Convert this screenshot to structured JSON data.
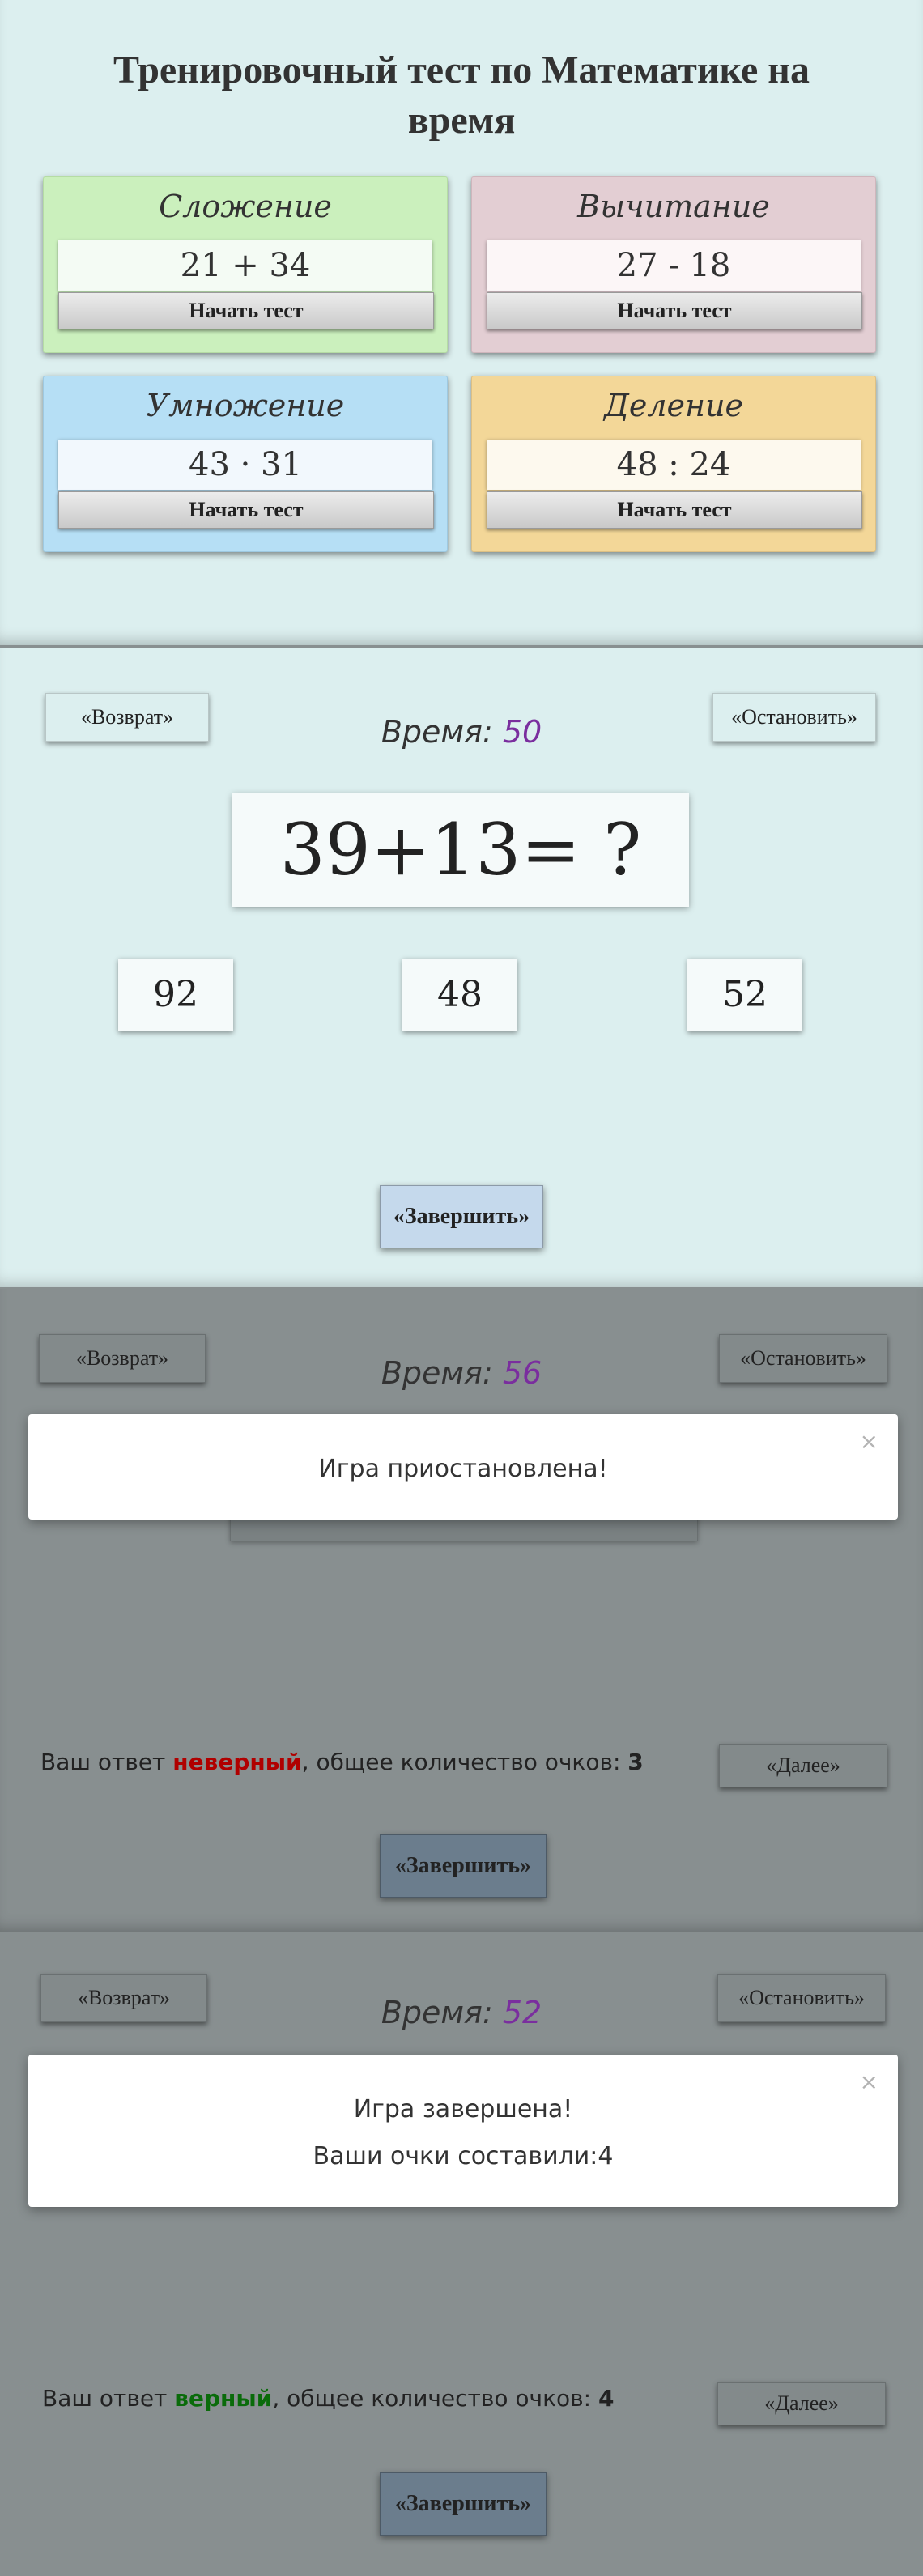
{
  "menu": {
    "title": "Тренировочный тест по Математике на время",
    "cards": [
      {
        "title": "Сложение",
        "expr": "21 + 34",
        "button": "Начать тест",
        "color": "#cbf0bd"
      },
      {
        "title": "Вычитание",
        "expr": "27 - 18",
        "button": "Начать тест",
        "color": "#e3ced3"
      },
      {
        "title": "Умножение",
        "expr": "43 · 31",
        "button": "Начать тест",
        "color": "#b6dff5"
      },
      {
        "title": "Деление",
        "expr": "48 : 24",
        "button": "Начать тест",
        "color": "#f3d798"
      }
    ]
  },
  "game": {
    "back_label": "«Возврат»",
    "pause_label": "«Остановить»",
    "timer_label": "Время:",
    "timer_value": "50",
    "question": "39+13= ?",
    "answers": [
      "92",
      "48",
      "52"
    ],
    "finish_label": "«Завершить»"
  },
  "paused": {
    "back_label": "«Возврат»",
    "pause_label": "«Остановить»",
    "timer_label": "Время:",
    "timer_value": "56",
    "modal_close": "×",
    "modal_message": "Игра приостановлена!",
    "feedback_prefix": "Ваш ответ ",
    "feedback_result": "неверный",
    "feedback_suffix": ", общее количество очков: ",
    "feedback_score": "3",
    "next_label": "«Далее»",
    "finish_label": "«Завершить»"
  },
  "finished": {
    "back_label": "«Возврат»",
    "pause_label": "«Остановить»",
    "timer_label": "Время:",
    "timer_value": "52",
    "modal_close": "×",
    "modal_title": "Игра завершена!",
    "modal_score": "Ваши очки составили:4",
    "feedback_prefix": "Ваш ответ ",
    "feedback_result": "верный",
    "feedback_suffix": ", общее количество очков: ",
    "feedback_score": "4",
    "next_label": "«Далее»",
    "finish_label": "«Завершить»"
  },
  "colors": {
    "background": "#dcefef",
    "overlay": "#888f90",
    "timer_number": "#7a2e9e",
    "wrong": "#b00000",
    "right": "#0a6b0a"
  }
}
